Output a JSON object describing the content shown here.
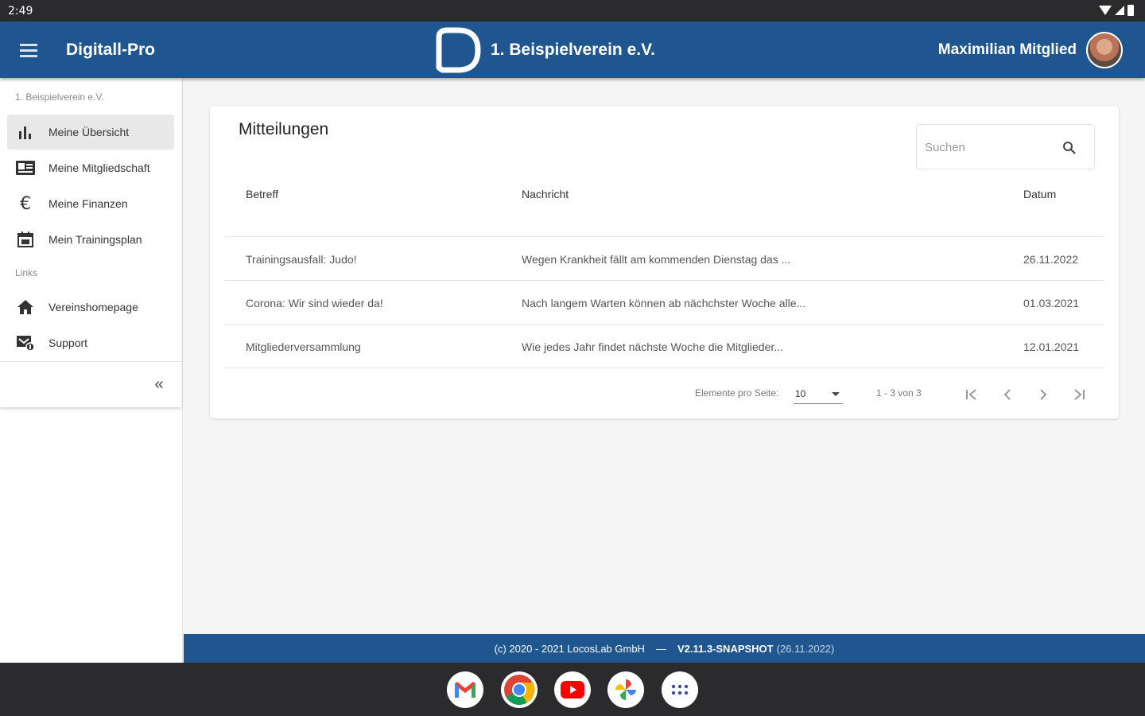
{
  "status_bar": {
    "time": "2:49"
  },
  "app_bar": {
    "app_title": "Digitall-Pro",
    "club_name": "1. Beispielverein e.V.",
    "user_name": "Maximilian Mitglied"
  },
  "sidebar": {
    "club_caption": "1. Beispielverein e.V.",
    "items": [
      {
        "label": "Meine Übersicht",
        "icon": "bar-chart-icon"
      },
      {
        "label": "Meine Mitgliedschaft",
        "icon": "id-card-icon"
      },
      {
        "label": "Meine Finanzen",
        "icon": "euro-icon"
      },
      {
        "label": "Mein Trainingsplan",
        "icon": "calendar-icon"
      }
    ],
    "links_caption": "Links",
    "links": [
      {
        "label": "Vereinshomepage",
        "icon": "home-icon"
      },
      {
        "label": "Support",
        "icon": "support-icon"
      }
    ],
    "collapse_symbol": "«"
  },
  "messages": {
    "title": "Mitteilungen",
    "search_placeholder": "Suchen",
    "columns": {
      "subject": "Betreff",
      "message": "Nachricht",
      "date": "Datum"
    },
    "rows": [
      {
        "subject": "Trainingsausfall: Judo!",
        "message": "Wegen Krankheit fällt am kommenden Dienstag das ...",
        "date": "26.11.2022"
      },
      {
        "subject": "Corona: Wir sind wieder da!",
        "message": "Nach langem Warten können ab nächchster Woche alle...",
        "date": "01.03.2021"
      },
      {
        "subject": "Mitgliederversammlung",
        "message": "Wie jedes Jahr findet nächste Woche die Mitglieder...",
        "date": "12.01.2021"
      }
    ],
    "pagination": {
      "items_per_page_label": "Elemente pro Seite:",
      "items_per_page": "10",
      "range": "1 - 3 von 3"
    }
  },
  "footer": {
    "copyright": "(c) 2020 - 2021 LocosLab GmbH",
    "separator": "—",
    "version": "V2.11.3-SNAPSHOT",
    "build_date": "(26.11.2022)"
  },
  "dock": [
    {
      "icon": "gmail-icon"
    },
    {
      "icon": "chrome-icon"
    },
    {
      "icon": "youtube-icon"
    },
    {
      "icon": "photos-icon"
    },
    {
      "icon": "app-drawer-icon"
    }
  ],
  "colors": {
    "brand_blue": "#1f5690",
    "system_bar": "#2b2b2e",
    "background": "#f5f5f5"
  }
}
